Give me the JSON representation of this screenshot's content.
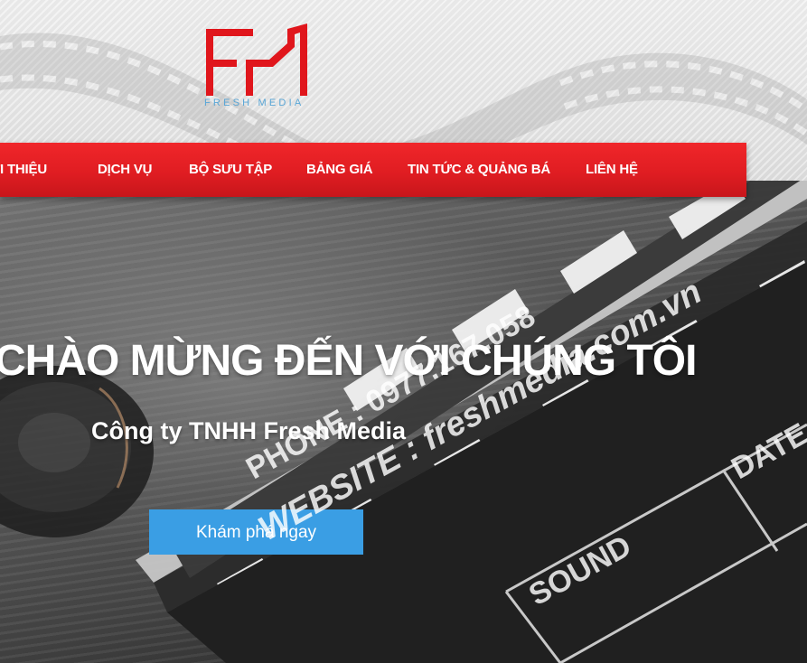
{
  "brand": {
    "logo_text": "FRESH MEDIA",
    "logo_color": "#e0161c",
    "logo_text_color": "#5aa6d6"
  },
  "nav": {
    "background": "#e01d22",
    "items": [
      {
        "label": "GIỚI THIỆU"
      },
      {
        "label": "DỊCH VỤ"
      },
      {
        "label": "BỘ SƯU TẬP"
      },
      {
        "label": "BẢNG GIÁ"
      },
      {
        "label": "TIN TỨC & QUẢNG BÁ"
      },
      {
        "label": "LIÊN HỆ"
      }
    ]
  },
  "hero": {
    "title": "CHÀO MỪNG ĐẾN VỚI CHÚNG TÔI",
    "subtitle": "Công ty TNHH Fresh Media",
    "cta_label": "Khám phá ngay",
    "cta_color": "#3a9ee4",
    "clapper": {
      "phone": "PHONE : 0977.167.058",
      "website": "WEBSITE : freshmedia.com.vn",
      "sound": "SOUND",
      "date": "DATE"
    }
  }
}
